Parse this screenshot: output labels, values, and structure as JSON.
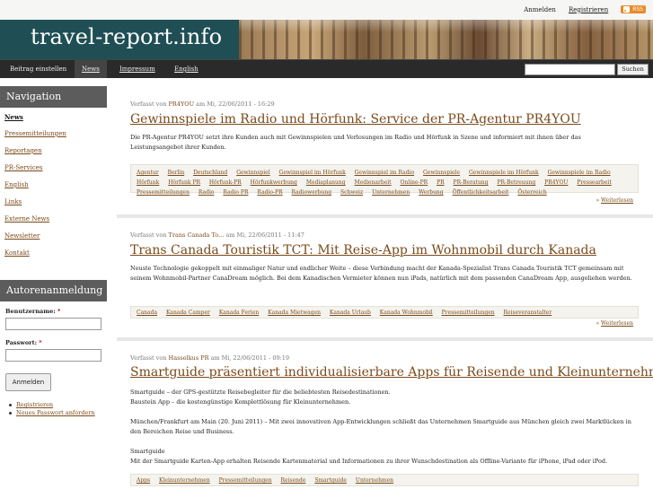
{
  "topbar": {
    "login": "Anmelden",
    "register": "Registrieren",
    "rss": "RSS"
  },
  "header": {
    "site_title": "travel-report.info"
  },
  "nav": {
    "items": [
      "Beitrag einstellen",
      "News",
      "Impressum",
      "English"
    ],
    "search_button": "Suchen"
  },
  "sidebar": {
    "navigation_title": "Navigation",
    "links": [
      "News",
      "Pressemitteilungen",
      "Reportagen",
      "PR-Services",
      "English",
      "Links",
      "Externe News",
      "Newsletter",
      "Kontakt"
    ],
    "login_title": "Autorenanmeldung",
    "username_label": "Benutzername:",
    "password_label": "Passwort:",
    "required_mark": "*",
    "login_button": "Anmelden",
    "register_link": "Registrieren",
    "new_password_link": "Neues Passwort anfordern"
  },
  "posts": [
    {
      "meta_prefix": "Verfasst von",
      "author": "PR4YOU",
      "date": "am Mi, 22/06/2011 - 16:29",
      "title": "Gewinnspiele im Radio und Hörfunk: Service der PR-Agentur PR4YOU",
      "body": [
        "Die PR-Agentur PR4YOU setzt ihre Kunden auch mit Gewinnspielen und Verlosungen im Radio und Hörfunk in Szene und informiert mit ihnen über das Leistungsangebot ihrer Kunden."
      ],
      "tags": [
        "Agentur",
        "Berlin",
        "Deutschland",
        "Gewinnspiel",
        "Gewinnspiel im Hörfunk",
        "Gewinnspiel im Radio",
        "Gewinnspiele",
        "Gewinnspiele im Hörfunk",
        "Gewinnspiele im Radio",
        "Hörfunk",
        "Hörfunk PR",
        "Hörfunk-PR",
        "Hörfunkwerbung",
        "Mediaplanung",
        "Medienarbeit",
        "Online-PR",
        "PR",
        "PR-Beratung",
        "PR-Betreuung",
        "PR4YOU",
        "Pressearbeit",
        "Pressemitteilungen",
        "Radio",
        "Radio PR",
        "Radio-PR",
        "Radiowerbung",
        "Schweiz",
        "Unternehmen",
        "Werbung",
        "Öffentlichkeitsarbeit",
        "Österreich"
      ],
      "more": "Weiterlesen"
    },
    {
      "meta_prefix": "Verfasst von",
      "author": "Trans Canada To...",
      "date": "am Mi, 22/06/2011 - 11:47",
      "title": "Trans Canada Touristik TCT: Mit Reise-App im Wohnmobil durch Kanada",
      "body": [
        "Neuste Technologie gekoppelt mit einmaliger Natur und endlicher Weite – diese Verbindung macht der Kanada-Spezialist Trans Canada Touristik TCT gemeinsam mit seinem Wohnmobil-Partner CanaDream möglich. Bei dem Kanadischen Vermieter können nun iPads, natürlich mit dem passenden CanaDream App, ausgeliehen werden."
      ],
      "tags": [
        "Canada",
        "Kanada Camper",
        "Kanada Ferien",
        "Kanada Mietwagen",
        "Kanada Urlaub",
        "Kanada Wohnmobil",
        "Pressemitteilungen",
        "Reiseveranstalter"
      ],
      "more": "Weiterlesen"
    },
    {
      "meta_prefix": "Verfasst von",
      "author": "Hasselkus PR",
      "date": "am Mi, 22/06/2011 - 09:19",
      "title": "Smartguide präsentiert individualisierbare Apps für Reisende und Kleinunternehmen",
      "body": [
        "Smartguide – der GPS-gestützte Reisebegleiter für die beliebtesten Reisedestinationen.",
        "Baustein App – die kostengünstige Komplettlösung für Kleinunternehmen.",
        "München/Frankfurt am Main (20. Juni 2011) – Mit zwei innovativen App-Entwicklungen schließt das Unternehmen Smartguide aus München gleich zwei Marktlücken in den Bereichen Reise und Business.",
        "Smartguide",
        "Mit der Smartguide Karten-App erhalten Reisende Kartenmaterial und Informationen zu ihrer Wunschdestination als Offline-Variante für iPhone, iPad oder iPod."
      ],
      "tags": [
        "Apps",
        "Kleinunternehmen",
        "Pressemitteilungen",
        "Reisende",
        "Smartguide",
        "Unternehmen"
      ],
      "more": ""
    }
  ],
  "colors": {
    "header_bg": "#1f4f55",
    "nav_bg": "#2a2a2a",
    "sidebar_head": "#5c5c5c",
    "link": "#7a4a1a",
    "rss": "#e88a2a"
  }
}
